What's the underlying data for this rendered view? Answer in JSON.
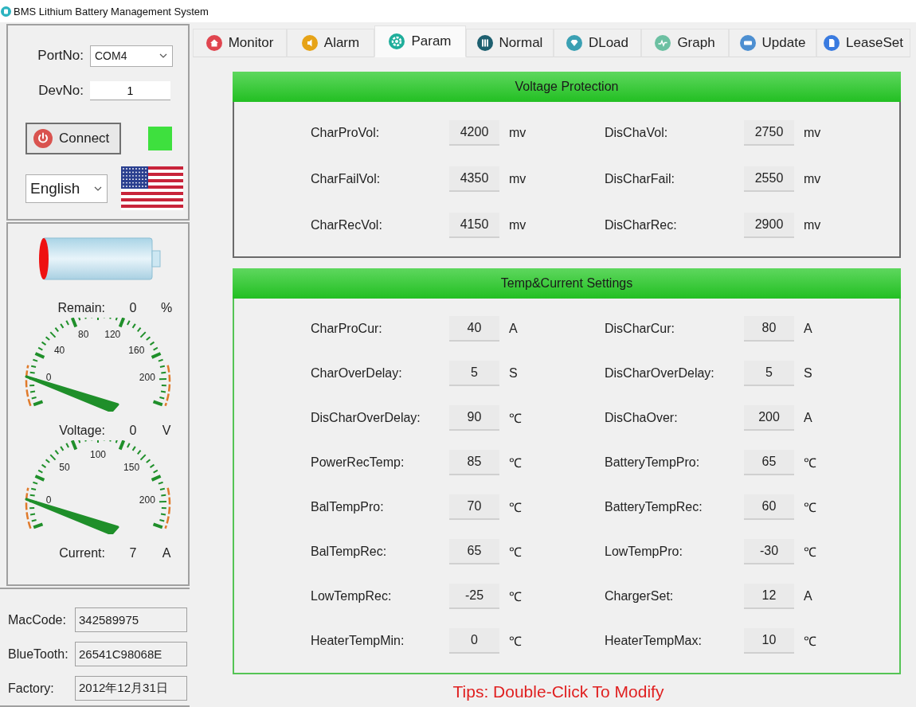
{
  "window": {
    "title": "BMS Lithium Battery Management System"
  },
  "connection": {
    "port_label": "PortNo:",
    "port_value": "COM4",
    "dev_label": "DevNo:",
    "dev_value": "1",
    "connect_button": "Connect",
    "indicator_on": true,
    "language": "English"
  },
  "readings": [
    {
      "label": "Remain:",
      "value": "0",
      "unit": "%",
      "gauge": {
        "ticks": [
          "0",
          "40",
          "80",
          "120",
          "160",
          "200"
        ]
      }
    },
    {
      "label": "Voltage:",
      "value": "0",
      "unit": "V",
      "gauge": {
        "ticks": [
          "0",
          "50",
          "100",
          "150",
          "200"
        ]
      }
    },
    {
      "label": "Current:",
      "value": "7",
      "unit": "A"
    }
  ],
  "info": [
    {
      "label": "MacCode:",
      "value": "342589975"
    },
    {
      "label": "BlueTooth:",
      "value": "26541C98068E"
    },
    {
      "label": "Factory:",
      "value": "2012年12月31日"
    }
  ],
  "tabs": [
    {
      "label": "Monitor",
      "selected": false
    },
    {
      "label": "Alarm",
      "selected": false
    },
    {
      "label": "Param",
      "selected": true
    },
    {
      "label": "Normal",
      "selected": false
    },
    {
      "label": "DLoad",
      "selected": false
    },
    {
      "label": "Graph",
      "selected": false
    },
    {
      "label": "Update",
      "selected": false
    },
    {
      "label": "LeaseSet",
      "selected": false
    }
  ],
  "groups": [
    {
      "title": "Voltage Protection",
      "fields": [
        {
          "label": "CharProVol:",
          "value": "4200",
          "unit": "mv"
        },
        {
          "label": "DisChaVol:",
          "value": "2750",
          "unit": "mv"
        },
        {
          "label": "CharFailVol:",
          "value": "4350",
          "unit": "mv"
        },
        {
          "label": "DisCharFail:",
          "value": "2550",
          "unit": "mv"
        },
        {
          "label": "CharRecVol:",
          "value": "4150",
          "unit": "mv"
        },
        {
          "label": "DisCharRec:",
          "value": "2900",
          "unit": "mv"
        }
      ]
    },
    {
      "title": "Temp&Current Settings",
      "fields": [
        {
          "label": "CharProCur:",
          "value": "40",
          "unit": "A"
        },
        {
          "label": "DisCharCur:",
          "value": "80",
          "unit": "A"
        },
        {
          "label": "CharOverDelay:",
          "value": "5",
          "unit": "S"
        },
        {
          "label": "DisCharOverDelay:",
          "value": "5",
          "unit": "S"
        },
        {
          "label": "DisCharOverDelay:",
          "value": "90",
          "unit": "℃"
        },
        {
          "label": "DisChaOver:",
          "value": "200",
          "unit": "A"
        },
        {
          "label": "PowerRecTemp:",
          "value": "85",
          "unit": "℃"
        },
        {
          "label": "BatteryTempPro:",
          "value": "65",
          "unit": "℃"
        },
        {
          "label": "BalTempPro:",
          "value": "70",
          "unit": "℃"
        },
        {
          "label": "BatteryTempRec:",
          "value": "60",
          "unit": "℃"
        },
        {
          "label": "BalTempRec:",
          "value": "65",
          "unit": "℃"
        },
        {
          "label": "LowTempPro:",
          "value": "-30",
          "unit": "℃"
        },
        {
          "label": "LowTempRec:",
          "value": "-25",
          "unit": "℃"
        },
        {
          "label": "ChargerSet:",
          "value": "12",
          "unit": "A"
        },
        {
          "label": "HeaterTempMin:",
          "value": "0",
          "unit": "℃"
        },
        {
          "label": "HeaterTempMax:",
          "value": "10",
          "unit": "℃"
        }
      ]
    }
  ],
  "tips": "Tips: Double-Click To Modify"
}
